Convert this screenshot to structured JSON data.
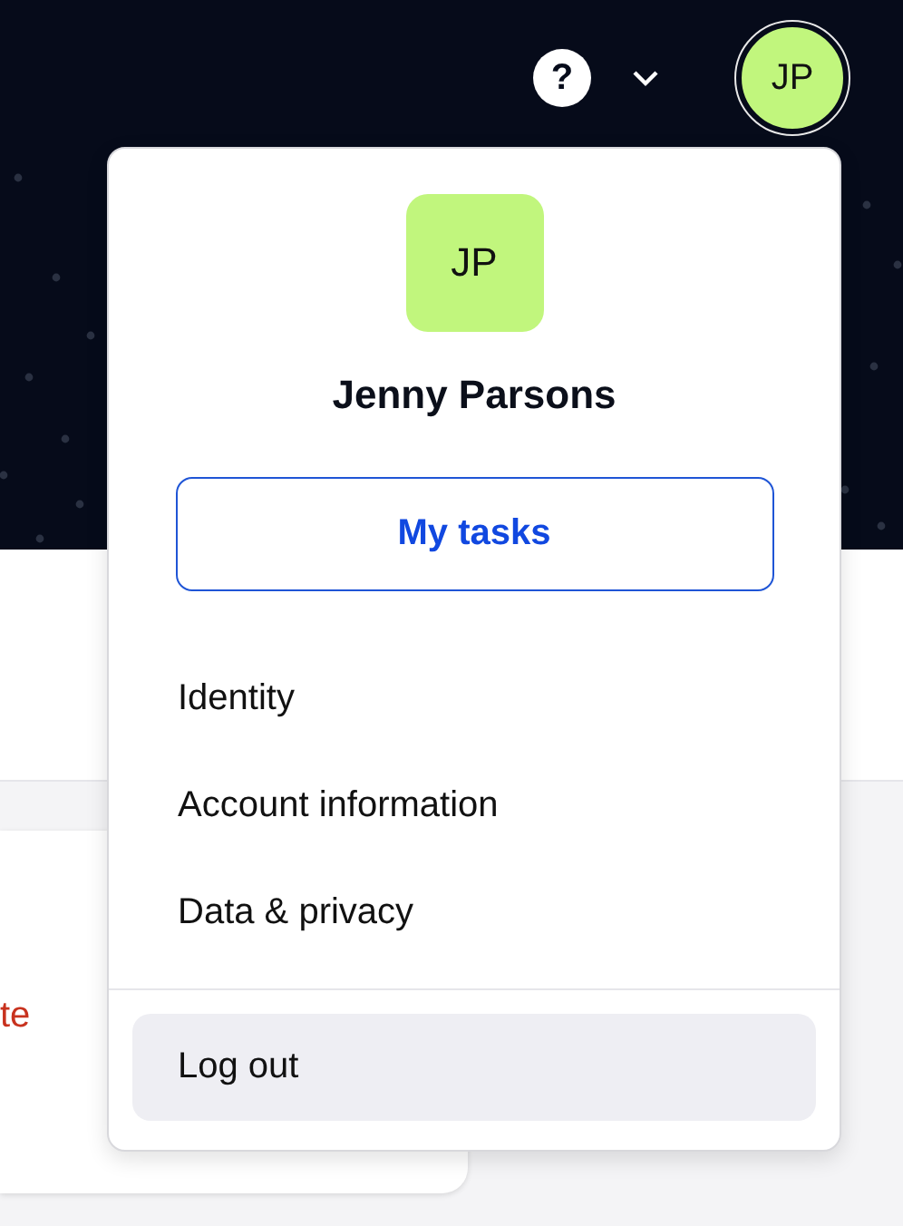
{
  "header": {
    "help_icon": "?",
    "user_initials": "JP"
  },
  "background_card": {
    "text": "te"
  },
  "menu": {
    "initials": "JP",
    "name": "Jenny Parsons",
    "primary_button": "My tasks",
    "items": [
      {
        "label": "Identity",
        "selected": false
      },
      {
        "label": "Account information",
        "selected": false
      },
      {
        "label": "Data & privacy",
        "selected": false
      }
    ],
    "logout": {
      "label": "Log out",
      "selected": true
    }
  }
}
